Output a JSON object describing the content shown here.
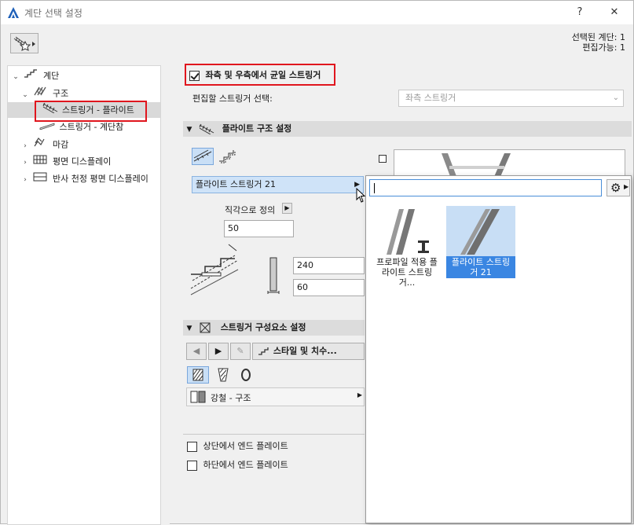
{
  "window": {
    "title": "계단 선택 설정",
    "help_label": "?",
    "close_label": "✕"
  },
  "header": {
    "favorites_icon": "stair-star-icon",
    "selected_label": "선택된 계단: 1",
    "editable_label": "편집가능: 1"
  },
  "tree": {
    "root": "계단",
    "structure": "구조",
    "stringer_plate": "스트링거 - 플라이트",
    "stringer_landing": "스트링거 - 계단참",
    "finish": "마감",
    "floor_plan": "평면 디스플레이",
    "rcp": "반사 천정 평면 디스플레이"
  },
  "main": {
    "uniform_checkbox": "좌측 및 우측에서 균일 스트링거",
    "uniform_checked": true,
    "select_edit_label": "편집할 스트링거 선택:",
    "select_edit_value": "좌측 스트링거",
    "flight_section": "플라이트 구조 설정",
    "stringer_type_value": "플라이트 스트링거 21",
    "perpendicular_label": "직각으로 정의",
    "offset_value": "50",
    "height_value": "240",
    "thickness_value": "60",
    "component_section": "스트링거 구성요소 설정",
    "style_dimension_label": "스타일 및 치수...",
    "material_value": "강철 - 구조",
    "top_end_plate": "상단에서 엔드 플레이트",
    "bottom_end_plate": "하단에서 엔드 플레이트"
  },
  "popup": {
    "search_value": "",
    "items": [
      {
        "label": "프로파일 적용 플라이트 스트링거...",
        "selected": false
      },
      {
        "label": "플라이트 스트링거 21",
        "selected": true
      }
    ]
  },
  "colors": {
    "highlight": "#e0161e",
    "selection": "#3a86e2",
    "selection_bg": "#c8def5"
  }
}
